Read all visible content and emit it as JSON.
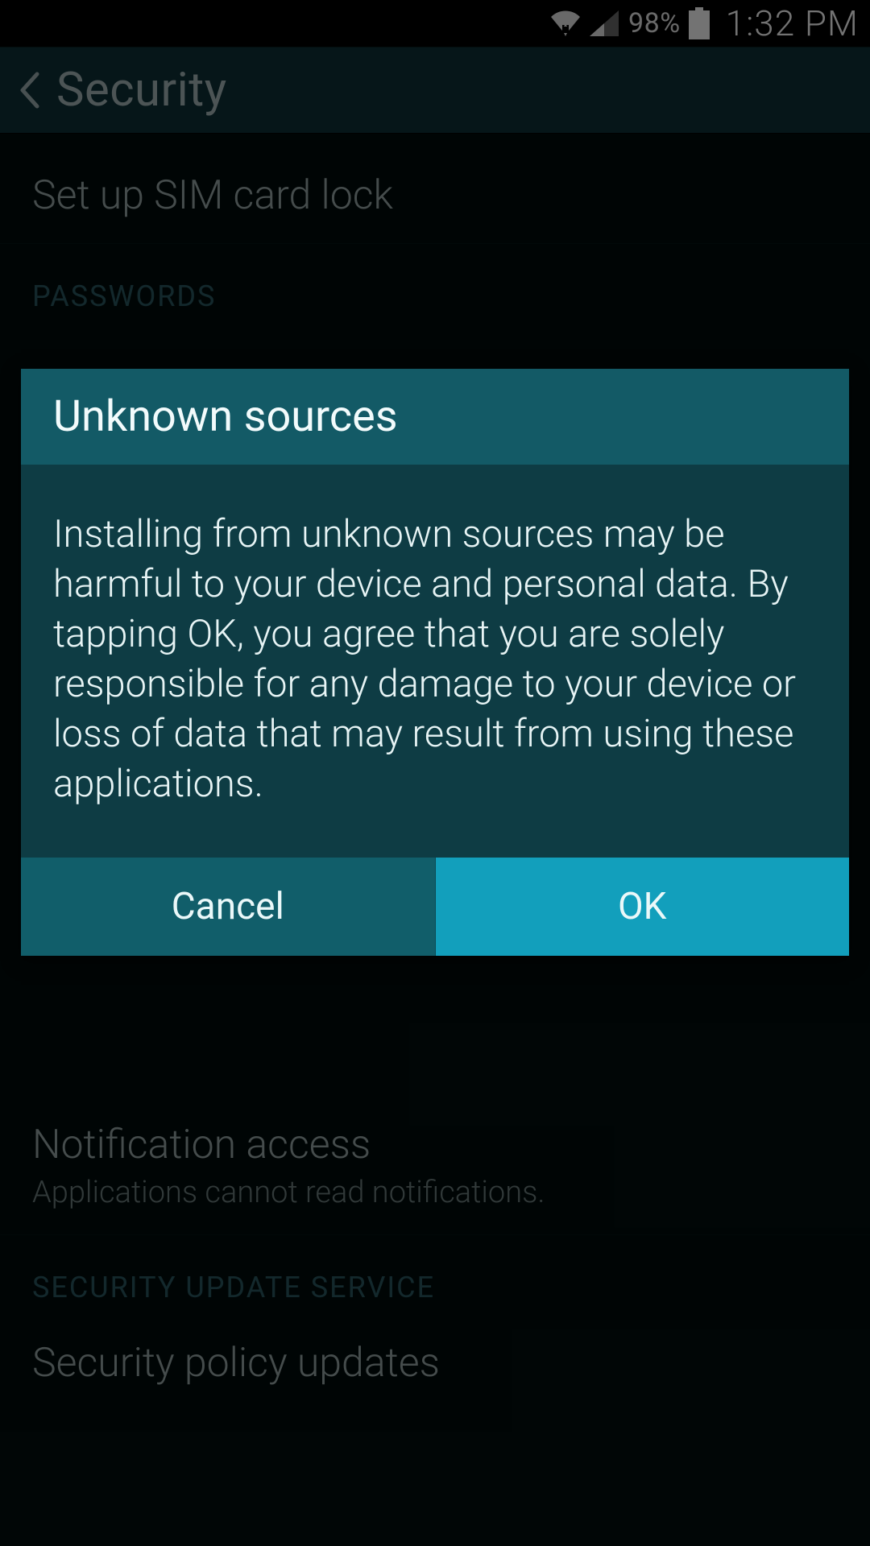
{
  "status": {
    "battery_pct": "98%",
    "time": "1:32 PM"
  },
  "actionbar": {
    "title": "Security"
  },
  "list": {
    "sim_lock": "Set up SIM card lock",
    "section_passwords": "PASSWORDS",
    "notification_access_title": "Notification access",
    "notification_access_sub": "Applications cannot read notifications.",
    "section_security_update": "SECURITY UPDATE SERVICE",
    "security_policy_updates": "Security policy updates"
  },
  "dialog": {
    "title": "Unknown sources",
    "body": "Installing from unknown sources may be harmful to your device and personal data. By tapping OK, you agree that you are solely responsible for any damage to your device or loss of data that may result from using these applications.",
    "cancel": "Cancel",
    "ok": "OK"
  }
}
